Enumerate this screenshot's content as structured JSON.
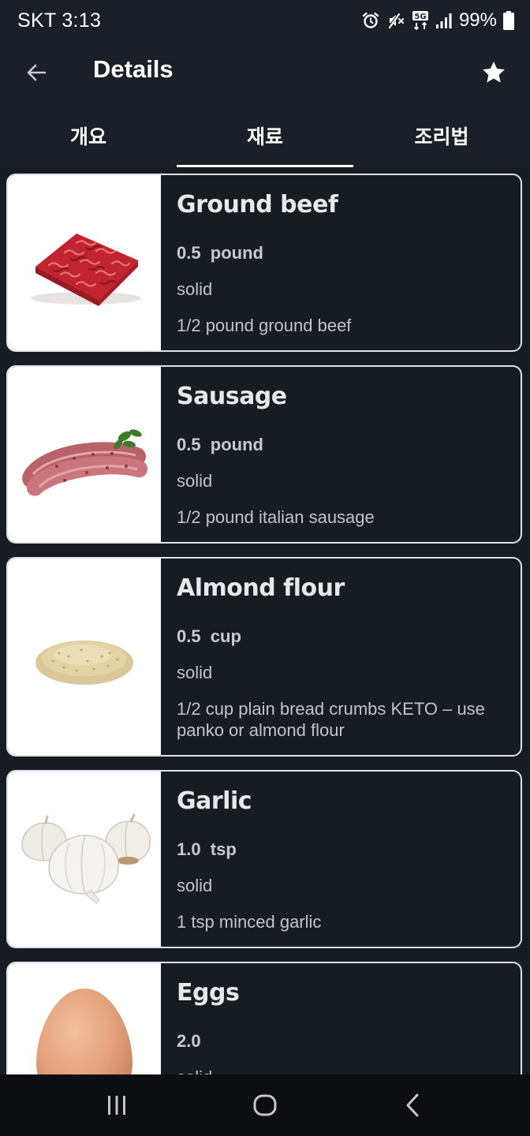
{
  "status_bar": {
    "time": "SKT 3:13",
    "battery": "99%",
    "icons": [
      "alarm-icon",
      "mute-icon",
      "5g-icon",
      "signal-icon",
      "battery-icon"
    ]
  },
  "app_bar": {
    "title": "Details",
    "back_icon": "arrow-left-icon",
    "favorite_icon": "star-icon"
  },
  "tabs": [
    {
      "label": "개요",
      "active": false
    },
    {
      "label": "재료",
      "active": true
    },
    {
      "label": "조리법",
      "active": false
    }
  ],
  "ingredients": [
    {
      "name": "Ground beef",
      "amount": "0.5  pound",
      "state": "solid",
      "description": "1/2 pound ground beef",
      "image": "ground-beef-image"
    },
    {
      "name": "Sausage",
      "amount": "0.5  pound",
      "state": "solid",
      "description": "1/2 pound italian sausage",
      "image": "sausage-image"
    },
    {
      "name": "Almond flour",
      "amount": "0.5  cup",
      "state": "solid",
      "description": "1/2 cup plain bread crumbs KETO – use panko or almond flour",
      "image": "almond-flour-image"
    },
    {
      "name": "Garlic",
      "amount": "1.0  tsp",
      "state": "solid",
      "description": "1 tsp minced garlic",
      "image": "garlic-image"
    },
    {
      "name": "Eggs",
      "amount": "2.0",
      "state": "solid",
      "description": "",
      "image": "egg-image"
    }
  ],
  "nav_bar": {
    "icons": [
      "recent-apps-icon",
      "home-icon",
      "back-icon"
    ]
  },
  "colors": {
    "background": "#171b22",
    "header": "#1b1f27",
    "card_border": "#dfe2e6",
    "nav_bar": "#0c0e12"
  }
}
